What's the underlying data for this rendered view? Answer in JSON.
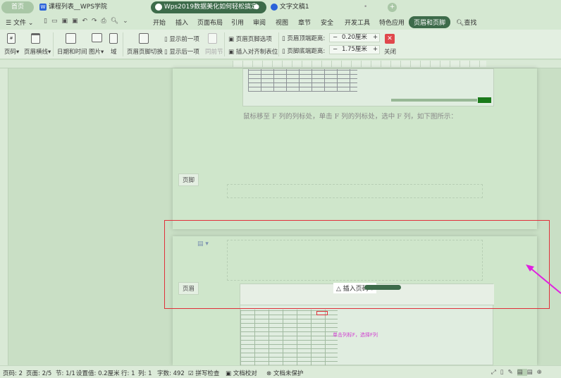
{
  "tabs": [
    {
      "label": "首页"
    },
    {
      "label": "课程列表__WPS学院"
    },
    {
      "label": "Wps2019数据美化如何轻松搞定"
    },
    {
      "label": "文字文稿1"
    }
  ],
  "menu": {
    "file": "文件",
    "items": [
      "开始",
      "插入",
      "页面布局",
      "引用",
      "审阅",
      "视图",
      "章节",
      "安全",
      "开发工具",
      "特色应用",
      "页眉和页脚"
    ],
    "search": "查找"
  },
  "toolbar": {
    "page_number": "页码",
    "header_line": "页眉横线",
    "date_time": "日期和时间",
    "picture": "图片",
    "field": "域",
    "switch": "页眉页脚切换",
    "show_prev": "显示前一项",
    "show_next": "显示后一项",
    "same_as_prev": "同前节",
    "options": "页眉页脚选项",
    "insert_tab": "插入对齐制表位",
    "header_top_label": "页眉顶端距离:",
    "header_top_value": "0.20厘米",
    "footer_bottom_label": "页脚底端距离:",
    "footer_bottom_value": "1.75厘米",
    "minus": "−",
    "plus": "+",
    "close": "关闭"
  },
  "document": {
    "paragraph": "鼠标移至 F 列的列标处，单击 F 列的列标处，选中 F 列，如下图所示：",
    "footer_label": "页脚",
    "header_label": "页眉",
    "embedded_popup": "插入页码",
    "embedded_annotation": "单击列标F，选择F列"
  },
  "status": {
    "page_num": "页码: 2",
    "pages": "页面: 2/5",
    "section": "节: 1/1",
    "setting": "设置值: 0.2厘米",
    "row": "行: 1",
    "col": "列: 1",
    "words": "字数: 492",
    "spell": "拼写检查",
    "proof": "文档校对",
    "protect": "文档未保护"
  },
  "colors": {
    "accent": "#3d6b4a",
    "highlight": "#e0303a",
    "arrow": "#e020e0"
  }
}
